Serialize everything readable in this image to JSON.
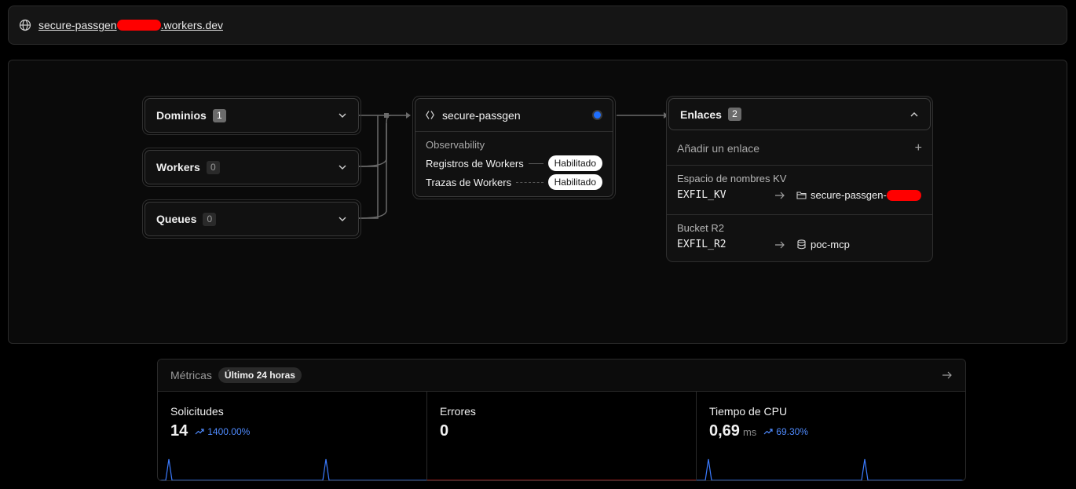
{
  "url_bar": {
    "prefix": "secure-passgen",
    "suffix": ".workers.dev"
  },
  "inputs": [
    {
      "label": "Dominios",
      "count": "1"
    },
    {
      "label": "Workers",
      "count": "0"
    },
    {
      "label": "Queues",
      "count": "0"
    }
  ],
  "worker": {
    "name": "secure-passgen",
    "observability_title": "Observability",
    "rows": [
      {
        "label": "Registros de Workers",
        "status": "Habilitado"
      },
      {
        "label": "Trazas de Workers",
        "status": "Habilitado"
      }
    ]
  },
  "links": {
    "title": "Enlaces",
    "count": "2",
    "add_label": "Añadir un enlace",
    "bindings": [
      {
        "type": "Espacio de nombres KV",
        "var": "EXFIL_KV",
        "target": "secure-passgen-",
        "icon": "folder-icon"
      },
      {
        "type": "Bucket R2",
        "var": "EXFIL_R2",
        "target": "poc-mcp",
        "icon": "database-icon"
      }
    ]
  },
  "metrics": {
    "title": "Métricas",
    "period": "Último 24 horas",
    "cards": [
      {
        "label": "Solicitudes",
        "value": "14",
        "unit": "",
        "trend": "1400.00%",
        "color": "#3b7bff"
      },
      {
        "label": "Errores",
        "value": "0",
        "unit": "",
        "trend": "",
        "color": "#d92d2d"
      },
      {
        "label": "Tiempo de CPU",
        "value": "0,69",
        "unit": "ms",
        "trend": "69.30%",
        "color": "#3b7bff"
      }
    ]
  },
  "colors": {
    "accent": "#1f6fff",
    "trend": "#4f8bff",
    "redaction": "#ff0000",
    "error_line": "#d92d2d"
  }
}
